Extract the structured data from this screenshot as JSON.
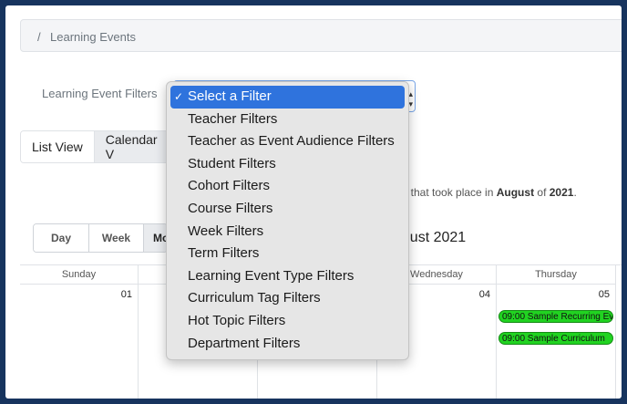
{
  "breadcrumb": {
    "separator": "/",
    "text": "Learning Events"
  },
  "filter": {
    "label": "Learning Event Filters",
    "options": [
      "Select a Filter",
      "Teacher Filters",
      "Teacher as Event Audience Filters",
      "Student Filters",
      "Cohort Filters",
      "Course Filters",
      "Week Filters",
      "Term Filters",
      "Learning Event Type Filters",
      "Curriculum Tag Filters",
      "Hot Topic Filters",
      "Department Filters"
    ],
    "selected_index": 0,
    "check_glyph": "✓"
  },
  "views": {
    "list": "List View",
    "calendar": "Calendar V"
  },
  "summary": {
    "prefix": "ts that took place in ",
    "month": "August",
    "mid": " of ",
    "year": "2021",
    "suffix": "."
  },
  "ranges": [
    "Day",
    "Week",
    "Mo"
  ],
  "month_title": "ugust 2021",
  "calendar": {
    "days": [
      "Sunday",
      "",
      "",
      "Wednesday",
      "Thursday"
    ],
    "dates": [
      "01",
      "",
      "",
      "04",
      "05"
    ],
    "events": [
      "09:00 Sample Recurring Ev",
      "09:00 Sample Curriculum"
    ]
  },
  "colors": {
    "accent": "#2f73dd",
    "event_green": "#21d321",
    "frame": "#17345e"
  }
}
